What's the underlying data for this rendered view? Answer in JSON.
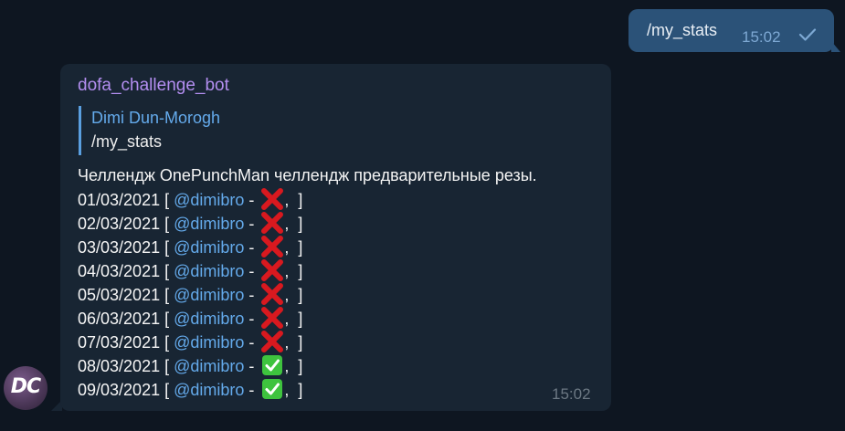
{
  "outgoing": {
    "text": "/my_stats",
    "time": "15:02",
    "status_icon": "single-check-icon"
  },
  "incoming": {
    "sender": "dofa_challenge_bot",
    "reply": {
      "name": "Dimi Dun-Morogh",
      "text": "/my_stats"
    },
    "header_line": "Челлендж OnePunchMan челлендж предварительные резы.",
    "rows": [
      {
        "date": "01/03/2021 [ ",
        "mention": "@dimibro",
        "sep": " - ",
        "status": "cross-mark-icon",
        "tail": ",  ]"
      },
      {
        "date": "02/03/2021 [ ",
        "mention": "@dimibro",
        "sep": " - ",
        "status": "cross-mark-icon",
        "tail": ",  ]"
      },
      {
        "date": "03/03/2021 [ ",
        "mention": "@dimibro",
        "sep": " - ",
        "status": "cross-mark-icon",
        "tail": ",  ]"
      },
      {
        "date": "04/03/2021 [ ",
        "mention": "@dimibro",
        "sep": " - ",
        "status": "cross-mark-icon",
        "tail": ",  ]"
      },
      {
        "date": "05/03/2021 [ ",
        "mention": "@dimibro",
        "sep": " - ",
        "status": "cross-mark-icon",
        "tail": ",  ]"
      },
      {
        "date": "06/03/2021 [ ",
        "mention": "@dimibro",
        "sep": " - ",
        "status": "cross-mark-icon",
        "tail": ",  ]"
      },
      {
        "date": "07/03/2021 [ ",
        "mention": "@dimibro",
        "sep": " - ",
        "status": "cross-mark-icon",
        "tail": ",  ]"
      },
      {
        "date": "08/03/2021 [ ",
        "mention": "@dimibro",
        "sep": " - ",
        "status": "check-mark-button-icon",
        "tail": ",  ]"
      },
      {
        "date": "09/03/2021 [ ",
        "mention": "@dimibro",
        "sep": " - ",
        "status": "check-mark-button-icon",
        "tail": ",  ]"
      }
    ],
    "time": "15:02"
  },
  "avatar": {
    "initials": "DC"
  },
  "colors": {
    "background": "#0e1621",
    "outgoing_bubble": "#2b5278",
    "incoming_bubble": "#182533",
    "sender_name": "#b38ef0",
    "link": "#64aaeb",
    "cross": "#d8191f",
    "check_bg": "#3ec33e"
  }
}
